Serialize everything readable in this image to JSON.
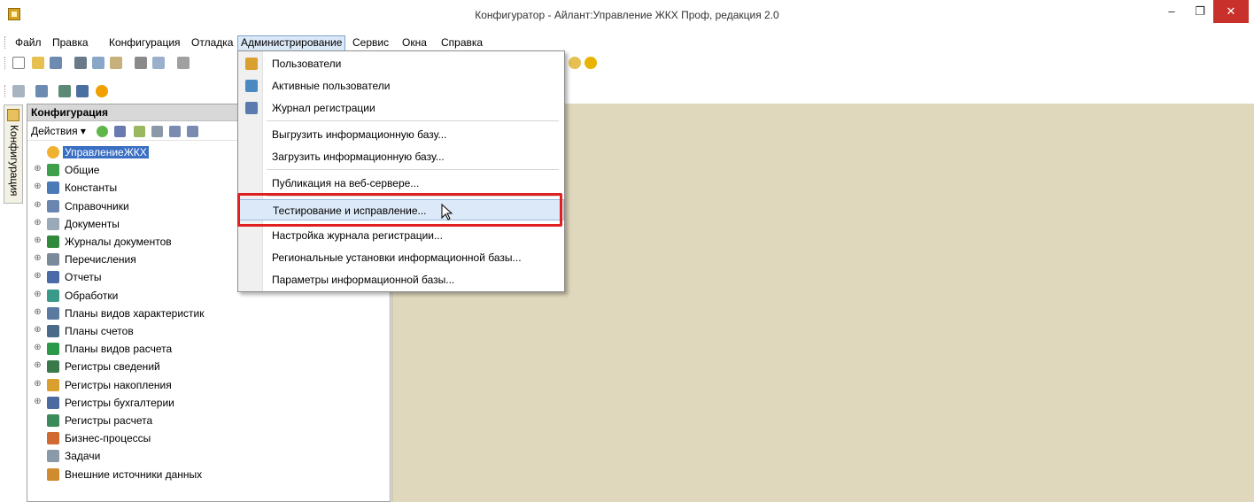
{
  "window": {
    "title": "Конфигуратор - Айлант:Управление ЖКХ Проф, редакция 2.0",
    "minimize": "–",
    "maximize": "❐",
    "close": "✕"
  },
  "menubar": {
    "items": [
      "Файл",
      "Правка",
      "Конфигурация",
      "Отладка",
      "Администрирование",
      "Сервис",
      "Окна",
      "Справка"
    ]
  },
  "left_tab": {
    "label": "Конфигурация"
  },
  "config_panel": {
    "title": "Конфигурация",
    "actions_label": "Действия ▾",
    "tree": [
      {
        "label": "УправлениеЖКХ",
        "expander": "",
        "icon_color": "#f0b030",
        "selected": true
      },
      {
        "label": "Общие",
        "expander": "⊕",
        "icon_color": "#3ea04a"
      },
      {
        "label": "Константы",
        "expander": "⊕",
        "icon_color": "#4a7ab8"
      },
      {
        "label": "Справочники",
        "expander": "⊕",
        "icon_color": "#6a86b0"
      },
      {
        "label": "Документы",
        "expander": "⊕",
        "icon_color": "#9aa8b8"
      },
      {
        "label": "Журналы документов",
        "expander": "⊕",
        "icon_color": "#2f8a3e"
      },
      {
        "label": "Перечисления",
        "expander": "⊕",
        "icon_color": "#7a8a9a"
      },
      {
        "label": "Отчеты",
        "expander": "⊕",
        "icon_color": "#4a6aa8"
      },
      {
        "label": "Обработки",
        "expander": "⊕",
        "icon_color": "#3a9a8a"
      },
      {
        "label": "Планы видов характеристик",
        "expander": "⊕",
        "icon_color": "#5a7aa0"
      },
      {
        "label": "Планы счетов",
        "expander": "⊕",
        "icon_color": "#4a6a8a"
      },
      {
        "label": "Планы видов расчета",
        "expander": "⊕",
        "icon_color": "#2a9a4a"
      },
      {
        "label": "Регистры сведений",
        "expander": "⊕",
        "icon_color": "#3a7a4a"
      },
      {
        "label": "Регистры накопления",
        "expander": "⊕",
        "icon_color": "#d9a030"
      },
      {
        "label": "Регистры бухгалтерии",
        "expander": "⊕",
        "icon_color": "#4a6aa0"
      },
      {
        "label": "Регистры расчета",
        "expander": "",
        "icon_color": "#3a8a5a"
      },
      {
        "label": "Бизнес-процессы",
        "expander": "",
        "icon_color": "#d06a30"
      },
      {
        "label": "Задачи",
        "expander": "",
        "icon_color": "#8a9aa8"
      },
      {
        "label": "Внешние источники данных",
        "expander": "",
        "icon_color": "#d08a30"
      }
    ]
  },
  "admin_menu": {
    "items": [
      {
        "label": "Пользователи",
        "icon_color": "#d9a030"
      },
      {
        "label": "Активные пользователи",
        "icon_color": "#4a8ac0"
      },
      {
        "label": "Журнал регистрации",
        "icon_color": "#5a7ab0"
      },
      {
        "label": "Выгрузить информационную базу...",
        "icon_color": ""
      },
      {
        "label": "Загрузить информационную базу...",
        "icon_color": ""
      },
      {
        "label": "Публикация на веб-сервере...",
        "icon_color": ""
      },
      {
        "label": "Тестирование и исправление...",
        "icon_color": "",
        "hot": true
      },
      {
        "label": "Настройка журнала регистрации...",
        "icon_color": ""
      },
      {
        "label": "Региональные установки информационной базы...",
        "icon_color": ""
      },
      {
        "label": "Параметры информационной базы...",
        "icon_color": ""
      }
    ]
  },
  "colors": {
    "workspace": "#e0d8bd",
    "highlight": "#e02020",
    "selection": "#3a6fc4",
    "close": "#c7302b"
  }
}
